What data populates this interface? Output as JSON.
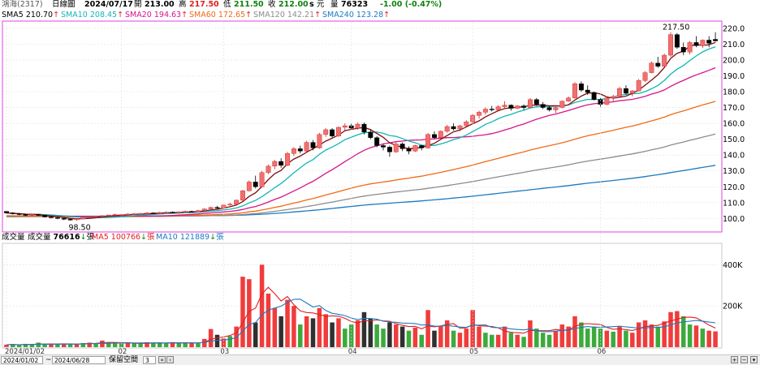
{
  "header": {
    "stock_name": "鴻海(2317)",
    "chart_kind": "日線圖",
    "date": "2024/07/17",
    "open_label": "開",
    "open": "213.00",
    "high_label": "高",
    "high": "217.50",
    "low_label": "低",
    "low": "211.50",
    "close_label": "收",
    "close": "212.00",
    "close_suffix": "s",
    "unit": "元",
    "volume_label": "量",
    "volume": "76323",
    "change": "-1.00 (-0.47%)"
  },
  "ma_legend": [
    {
      "label": "SMA5",
      "value": "210.70",
      "arrow": "↑",
      "color": "#000000"
    },
    {
      "label": "SMA10",
      "value": "208.45",
      "arrow": "↑",
      "color": "#13b5b5"
    },
    {
      "label": "SMA20",
      "value": "194.63",
      "arrow": "↑",
      "color": "#d4148c"
    },
    {
      "label": "SMA60",
      "value": "172.65",
      "arrow": "↑",
      "color": "#f06a14"
    },
    {
      "label": "SMA120",
      "value": "142.21",
      "arrow": "↑",
      "color": "#8c8c8c"
    },
    {
      "label": "SMA240",
      "value": "123.28",
      "arrow": "↑",
      "color": "#1c7ac0"
    }
  ],
  "volume_legend": {
    "panel_title": "成交量",
    "volume_label": "成交量",
    "volume_value": "76616",
    "volume_arrow": "↓",
    "volume_unit": "張",
    "ma5_label": "MA5",
    "ma5_value": "100766",
    "ma5_arrow": "↓",
    "ma5_unit": "張",
    "ma10_label": "MA10",
    "ma10_value": "121889",
    "ma10_arrow": "↓",
    "ma10_unit": "張"
  },
  "bottom_bar": {
    "start_date": "2024/01/02",
    "separator": "~",
    "end_date": "2024/06/28",
    "space_label": "保留空間",
    "space_value": "3"
  },
  "colors": {
    "up": "#f07070",
    "down": "#000000",
    "ma5": "#7a1010",
    "ma10": "#13b5b5",
    "ma20": "#d4148c",
    "ma60": "#f06a14",
    "ma120": "#8c8c8c",
    "ma240": "#1c7ac0",
    "vol_up": "#f03c3c",
    "vol_down": "#303030",
    "vol_flat": "#3caa3c",
    "frame": "#e040e0",
    "grid": "#e0e0e0"
  },
  "chart_data": {
    "type": "candlestick",
    "price_axis": {
      "ticks": [
        "100.0",
        "110.0",
        "120.0",
        "130.0",
        "140.0",
        "150.0",
        "160.0",
        "170.0",
        "180.0",
        "190.0",
        "200.0",
        "210.0",
        "220.0"
      ],
      "ylim": [
        92,
        224
      ]
    },
    "volume_axis": {
      "ticks": [
        "200K",
        "400K"
      ],
      "ylim": [
        0,
        500000
      ]
    },
    "x_axis": {
      "tick_labels": [
        "2024/01/02",
        "02",
        "03",
        "04",
        "05",
        "06"
      ],
      "tick_index": [
        0,
        18,
        34,
        54,
        73,
        93
      ]
    },
    "annotations": {
      "high_label": "217.50",
      "high_index": 104,
      "low_label": "98.50",
      "low_index": 11
    },
    "candles": [
      [
        104.5,
        105.0,
        103.0,
        103.5
      ],
      [
        103.5,
        104.0,
        102.5,
        103.0
      ],
      [
        103.0,
        103.5,
        102.0,
        102.5
      ],
      [
        102.5,
        103.0,
        101.5,
        102.0
      ],
      [
        102.0,
        103.0,
        101.5,
        102.5
      ],
      [
        102.5,
        103.0,
        101.5,
        102.0
      ],
      [
        102.0,
        102.5,
        100.5,
        101.0
      ],
      [
        101.0,
        101.5,
        100.0,
        100.5
      ],
      [
        100.5,
        101.0,
        99.5,
        100.0
      ],
      [
        100.0,
        100.5,
        99.0,
        99.5
      ],
      [
        99.5,
        100.0,
        98.8,
        99.2
      ],
      [
        99.2,
        100.0,
        98.5,
        99.8
      ],
      [
        99.8,
        101.0,
        99.5,
        100.8
      ],
      [
        100.8,
        101.5,
        100.2,
        101.0
      ],
      [
        101.0,
        101.8,
        100.5,
        101.5
      ],
      [
        101.5,
        102.0,
        101.0,
        101.8
      ],
      [
        101.8,
        102.5,
        101.2,
        102.2
      ],
      [
        102.2,
        103.0,
        101.8,
        102.5
      ],
      [
        102.5,
        103.0,
        102.0,
        102.5
      ],
      [
        102.5,
        103.2,
        102.0,
        102.8
      ],
      [
        102.8,
        103.5,
        102.2,
        103.0
      ],
      [
        103.0,
        103.6,
        102.5,
        103.2
      ],
      [
        103.2,
        104.0,
        102.8,
        103.5
      ],
      [
        103.5,
        104.0,
        103.0,
        103.3
      ],
      [
        103.3,
        104.2,
        103.0,
        103.8
      ],
      [
        103.8,
        104.5,
        103.2,
        104.0
      ],
      [
        104.0,
        104.5,
        103.5,
        103.8
      ],
      [
        103.8,
        104.5,
        103.2,
        104.2
      ],
      [
        104.2,
        105.0,
        103.8,
        104.5
      ],
      [
        104.5,
        105.0,
        104.0,
        104.2
      ],
      [
        104.2,
        105.5,
        104.0,
        105.0
      ],
      [
        105.0,
        106.5,
        104.5,
        106.0
      ],
      [
        106.0,
        107.5,
        105.5,
        107.0
      ],
      [
        107.0,
        108.0,
        106.0,
        106.5
      ],
      [
        106.5,
        109.0,
        106.0,
        108.5
      ],
      [
        108.5,
        110.0,
        108.0,
        109.0
      ],
      [
        109.0,
        112.0,
        108.5,
        111.5
      ],
      [
        111.5,
        118.0,
        111.0,
        117.5
      ],
      [
        117.5,
        124.0,
        117.0,
        123.0
      ],
      [
        123.0,
        127.0,
        119.0,
        120.0
      ],
      [
        120.0,
        130.0,
        119.5,
        129.0
      ],
      [
        129.0,
        134.0,
        128.0,
        133.0
      ],
      [
        133.0,
        137.0,
        131.0,
        136.0
      ],
      [
        136.0,
        138.0,
        132.0,
        133.5
      ],
      [
        133.5,
        142.0,
        133.0,
        141.0
      ],
      [
        141.0,
        145.0,
        139.5,
        144.0
      ],
      [
        144.0,
        146.0,
        141.0,
        142.5
      ],
      [
        142.5,
        149.0,
        141.5,
        148.0
      ],
      [
        148.0,
        149.5,
        143.0,
        144.5
      ],
      [
        144.5,
        154.0,
        144.0,
        153.0
      ],
      [
        153.0,
        157.0,
        151.5,
        156.0
      ],
      [
        156.0,
        157.0,
        151.0,
        152.0
      ],
      [
        152.0,
        158.0,
        151.5,
        157.5
      ],
      [
        157.5,
        160.0,
        155.5,
        158.5
      ],
      [
        158.5,
        160.0,
        156.0,
        157.0
      ],
      [
        157.0,
        160.5,
        156.0,
        159.5
      ],
      [
        159.5,
        160.5,
        153.0,
        154.5
      ],
      [
        154.5,
        156.0,
        150.0,
        151.0
      ],
      [
        151.0,
        152.0,
        145.0,
        146.0
      ],
      [
        146.0,
        147.0,
        143.0,
        145.0
      ],
      [
        145.0,
        146.0,
        139.0,
        142.0
      ],
      [
        142.0,
        148.0,
        141.5,
        147.0
      ],
      [
        147.0,
        148.0,
        142.5,
        144.0
      ],
      [
        144.0,
        145.5,
        140.5,
        142.5
      ],
      [
        142.5,
        146.5,
        142.0,
        146.0
      ],
      [
        146.0,
        146.5,
        143.0,
        144.5
      ],
      [
        144.5,
        154.0,
        144.0,
        153.0
      ],
      [
        153.0,
        155.0,
        150.0,
        151.0
      ],
      [
        151.0,
        155.5,
        150.5,
        155.0
      ],
      [
        155.0,
        159.0,
        154.0,
        158.0
      ],
      [
        158.0,
        160.0,
        155.5,
        156.5
      ],
      [
        156.5,
        159.0,
        155.0,
        158.5
      ],
      [
        158.5,
        162.0,
        158.0,
        161.0
      ],
      [
        161.0,
        166.0,
        160.5,
        165.0
      ],
      [
        165.0,
        168.0,
        163.0,
        167.0
      ],
      [
        167.0,
        170.0,
        165.5,
        169.0
      ],
      [
        169.0,
        171.0,
        167.5,
        168.5
      ],
      [
        168.5,
        171.5,
        168.0,
        170.5
      ],
      [
        170.5,
        174.0,
        169.0,
        171.5
      ],
      [
        171.5,
        172.0,
        168.0,
        169.5
      ],
      [
        169.5,
        171.5,
        169.0,
        171.0
      ],
      [
        171.0,
        172.0,
        168.5,
        170.0
      ],
      [
        170.0,
        176.0,
        169.5,
        175.0
      ],
      [
        175.0,
        176.0,
        171.0,
        172.0
      ],
      [
        172.0,
        173.5,
        169.0,
        170.0
      ],
      [
        170.0,
        171.0,
        167.5,
        168.5
      ],
      [
        168.5,
        170.5,
        166.5,
        170.0
      ],
      [
        170.0,
        174.5,
        169.5,
        174.0
      ],
      [
        174.0,
        177.0,
        173.5,
        176.0
      ],
      [
        176.0,
        186.0,
        175.5,
        185.0
      ],
      [
        185.0,
        186.5,
        180.0,
        181.0
      ],
      [
        181.0,
        184.0,
        178.0,
        179.5
      ],
      [
        179.5,
        180.0,
        174.5,
        175.0
      ],
      [
        175.0,
        176.0,
        170.0,
        172.0
      ],
      [
        172.0,
        176.5,
        171.5,
        176.0
      ],
      [
        176.0,
        178.0,
        173.5,
        177.0
      ],
      [
        177.0,
        183.0,
        176.5,
        182.0
      ],
      [
        182.0,
        184.0,
        178.0,
        179.0
      ],
      [
        179.0,
        181.0,
        177.0,
        180.5
      ],
      [
        180.5,
        188.0,
        180.0,
        187.0
      ],
      [
        187.0,
        193.0,
        186.0,
        192.0
      ],
      [
        192.0,
        199.0,
        191.5,
        198.0
      ],
      [
        198.0,
        202.0,
        195.0,
        196.0
      ],
      [
        196.0,
        204.0,
        195.5,
        203.0
      ],
      [
        203.0,
        217.5,
        202.0,
        216.0
      ],
      [
        216.0,
        217.0,
        207.0,
        208.0
      ],
      [
        208.0,
        211.0,
        203.0,
        205.0
      ],
      [
        205.0,
        212.0,
        203.5,
        211.0
      ],
      [
        211.0,
        215.0,
        208.0,
        209.0
      ],
      [
        209.0,
        213.0,
        207.5,
        212.5
      ],
      [
        212.5,
        215.0,
        208.0,
        210.5
      ],
      [
        213.0,
        217.5,
        211.5,
        212.0
      ]
    ],
    "volumes": [
      [
        12000,
        "up"
      ],
      [
        14000,
        "flat"
      ],
      [
        10000,
        "flat"
      ],
      [
        16000,
        "flat"
      ],
      [
        12000,
        "flat"
      ],
      [
        22000,
        "flat"
      ],
      [
        15000,
        "flat"
      ],
      [
        13000,
        "up"
      ],
      [
        16000,
        "flat"
      ],
      [
        14000,
        "up"
      ],
      [
        18000,
        "flat"
      ],
      [
        14000,
        "up"
      ],
      [
        20000,
        "flat"
      ],
      [
        22000,
        "up"
      ],
      [
        18000,
        "flat"
      ],
      [
        32000,
        "up"
      ],
      [
        22000,
        "flat"
      ],
      [
        20000,
        "flat"
      ],
      [
        17000,
        "flat"
      ],
      [
        20000,
        "up"
      ],
      [
        18000,
        "flat"
      ],
      [
        16000,
        "flat"
      ],
      [
        24000,
        "up"
      ],
      [
        20000,
        "flat"
      ],
      [
        22000,
        "flat"
      ],
      [
        20000,
        "flat"
      ],
      [
        24000,
        "up"
      ],
      [
        18000,
        "flat"
      ],
      [
        22000,
        "flat"
      ],
      [
        20000,
        "up"
      ],
      [
        18000,
        "flat"
      ],
      [
        40000,
        "up"
      ],
      [
        88000,
        "up"
      ],
      [
        60000,
        "down"
      ],
      [
        42000,
        "up"
      ],
      [
        54000,
        "flat"
      ],
      [
        100000,
        "up"
      ],
      [
        342000,
        "up"
      ],
      [
        330000,
        "up"
      ],
      [
        120000,
        "down"
      ],
      [
        400000,
        "up"
      ],
      [
        260000,
        "up"
      ],
      [
        190000,
        "up"
      ],
      [
        150000,
        "down"
      ],
      [
        230000,
        "up"
      ],
      [
        200000,
        "up"
      ],
      [
        110000,
        "flat"
      ],
      [
        150000,
        "up"
      ],
      [
        140000,
        "down"
      ],
      [
        190000,
        "up"
      ],
      [
        160000,
        "up"
      ],
      [
        120000,
        "down"
      ],
      [
        140000,
        "up"
      ],
      [
        90000,
        "flat"
      ],
      [
        110000,
        "flat"
      ],
      [
        130000,
        "up"
      ],
      [
        170000,
        "down"
      ],
      [
        140000,
        "down"
      ],
      [
        110000,
        "flat"
      ],
      [
        90000,
        "flat"
      ],
      [
        120000,
        "down"
      ],
      [
        110000,
        "up"
      ],
      [
        100000,
        "down"
      ],
      [
        80000,
        "flat"
      ],
      [
        95000,
        "up"
      ],
      [
        60000,
        "flat"
      ],
      [
        180000,
        "up"
      ],
      [
        80000,
        "down"
      ],
      [
        100000,
        "up"
      ],
      [
        130000,
        "up"
      ],
      [
        80000,
        "flat"
      ],
      [
        70000,
        "up"
      ],
      [
        90000,
        "up"
      ],
      [
        180000,
        "up"
      ],
      [
        100000,
        "up"
      ],
      [
        70000,
        "flat"
      ],
      [
        60000,
        "flat"
      ],
      [
        60000,
        "up"
      ],
      [
        100000,
        "up"
      ],
      [
        70000,
        "flat"
      ],
      [
        60000,
        "up"
      ],
      [
        50000,
        "flat"
      ],
      [
        130000,
        "up"
      ],
      [
        90000,
        "flat"
      ],
      [
        70000,
        "flat"
      ],
      [
        60000,
        "flat"
      ],
      [
        80000,
        "up"
      ],
      [
        110000,
        "up"
      ],
      [
        100000,
        "up"
      ],
      [
        150000,
        "up"
      ],
      [
        120000,
        "flat"
      ],
      [
        90000,
        "flat"
      ],
      [
        100000,
        "flat"
      ],
      [
        90000,
        "flat"
      ],
      [
        80000,
        "up"
      ],
      [
        75000,
        "flat"
      ],
      [
        100000,
        "up"
      ],
      [
        80000,
        "flat"
      ],
      [
        70000,
        "up"
      ],
      [
        120000,
        "up"
      ],
      [
        130000,
        "up"
      ],
      [
        110000,
        "up"
      ],
      [
        100000,
        "flat"
      ],
      [
        125000,
        "up"
      ],
      [
        170000,
        "up"
      ],
      [
        175000,
        "up"
      ],
      [
        150000,
        "flat"
      ],
      [
        110000,
        "flat"
      ],
      [
        105000,
        "up"
      ],
      [
        90000,
        "flat"
      ],
      [
        80000,
        "up"
      ],
      [
        76616,
        "up"
      ]
    ]
  }
}
